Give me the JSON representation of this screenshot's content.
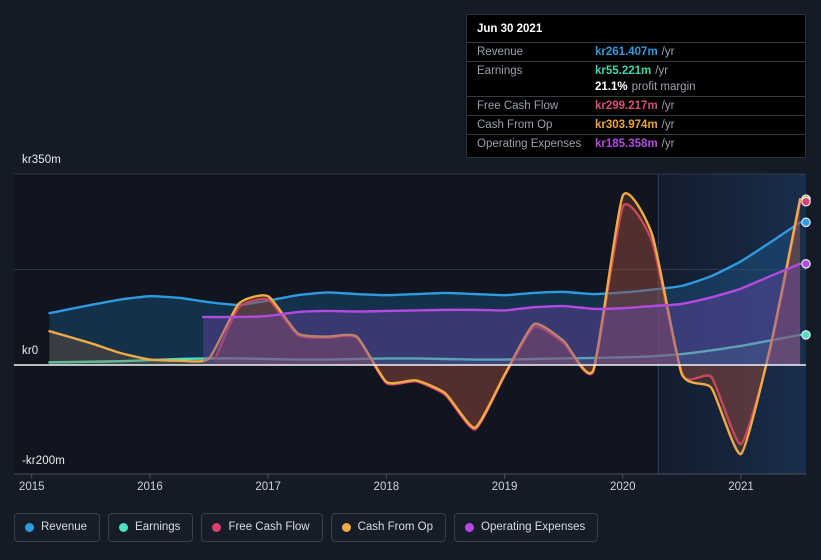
{
  "axis": {
    "y_labels": [
      {
        "text": "kr350m",
        "value": 350,
        "y": 161
      },
      {
        "text": "kr0",
        "value": 0,
        "y": 352
      },
      {
        "text": "-kr200m",
        "value": -200,
        "y": 462
      }
    ],
    "x_labels": [
      "2015",
      "2016",
      "2017",
      "2018",
      "2019",
      "2020",
      "2021"
    ]
  },
  "tooltip": {
    "date": "Jun 30 2021",
    "rows": [
      {
        "label": "Revenue",
        "value": "kr261.407m",
        "unit": "/yr",
        "color": "#2e9ae0"
      },
      {
        "label": "Earnings",
        "value": "kr55.221m",
        "unit": "/yr",
        "color": "#3ad6ae"
      },
      {
        "label": "",
        "value": "21.1%",
        "unit": "profit margin",
        "color": "#ffffff",
        "sub": true
      },
      {
        "label": "Free Cash Flow",
        "value": "kr299.217m",
        "unit": "/yr",
        "color": "#d84d7c"
      },
      {
        "label": "Cash From Op",
        "value": "kr303.974m",
        "unit": "/yr",
        "color": "#e8a33d"
      },
      {
        "label": "Operating Expenses",
        "value": "kr185.358m",
        "unit": "/yr",
        "color": "#b44ae0"
      }
    ]
  },
  "legend": {
    "items": [
      {
        "label": "Revenue",
        "color": "#2e9ae0"
      },
      {
        "label": "Earnings",
        "color": "#4fe0c0"
      },
      {
        "label": "Free Cash Flow",
        "color": "#d8416f"
      },
      {
        "label": "Cash From Op",
        "color": "#f0ab47"
      },
      {
        "label": "Operating Expenses",
        "color": "#b44ae0"
      }
    ]
  },
  "chart_data": {
    "type": "area",
    "title": "",
    "xlabel": "",
    "ylabel": "",
    "currency": "kr",
    "unit": "m",
    "ylim": [
      -200,
      350
    ],
    "grid": true,
    "gridlines": [
      350,
      175,
      0
    ],
    "zero_line": 0,
    "x": [
      "2015.00",
      "2015.25",
      "2015.50",
      "2015.75",
      "2016.00",
      "2016.25",
      "2016.50",
      "2016.75",
      "2017.00",
      "2017.25",
      "2017.50",
      "2017.75",
      "2018.00",
      "2018.25",
      "2018.50",
      "2018.75",
      "2019.00",
      "2019.25",
      "2019.50",
      "2019.75",
      "2020.00",
      "2020.25",
      "2020.50",
      "2020.75",
      "2021.00",
      "2021.25",
      "2021.50"
    ],
    "xlim": [
      "2014.85",
      "2021.55"
    ],
    "highlight_region_start": "2020.30",
    "series": [
      {
        "name": "Revenue",
        "color": "#2e9ae0",
        "fill": "rgba(30,95,150,0.38)",
        "start_x": "2015.15",
        "values": [
          null,
          95,
          110,
          120,
          126,
          123,
          115,
          110,
          118,
          128,
          133,
          130,
          128,
          130,
          132,
          130,
          128,
          132,
          134,
          130,
          133,
          138,
          145,
          163,
          190,
          225,
          261.407
        ]
      },
      {
        "name": "Earnings",
        "color": "#4fe0c0",
        "fill": "rgba(80,200,170,0.14)",
        "start_x": "2015.15",
        "values": [
          null,
          5,
          6,
          7,
          9,
          11,
          12,
          12,
          11,
          10,
          10,
          11,
          12,
          12,
          11,
          10,
          10,
          11,
          12,
          13,
          14,
          16,
          20,
          27,
          35,
          45,
          55.221
        ]
      },
      {
        "name": "Free Cash Flow",
        "color": "#d8416f",
        "fill": "rgba(150,55,80,0.30)",
        "start_x": "2016.55",
        "values": [
          null,
          null,
          null,
          null,
          null,
          null,
          10,
          105,
          120,
          55,
          50,
          50,
          -33,
          -30,
          -55,
          -118,
          -20,
          70,
          40,
          -12,
          290,
          225,
          -18,
          -22,
          -145,
          30,
          299.217
        ]
      },
      {
        "name": "Cash From Op",
        "color": "#f0ab47",
        "fill": "rgba(150,90,45,0.28)",
        "start_x": "2015.15",
        "values": [
          null,
          62,
          40,
          22,
          10,
          8,
          12,
          112,
          126,
          58,
          52,
          52,
          -31,
          -28,
          -52,
          -115,
          -18,
          75,
          44,
          -10,
          310,
          238,
          -16,
          -42,
          -163,
          35,
          303.974
        ]
      },
      {
        "name": "Operating Expenses",
        "color": "#b44ae0",
        "fill": "rgba(110,70,170,0.40)",
        "start_x": "2016.45",
        "values": [
          null,
          null,
          null,
          null,
          null,
          null,
          88,
          88,
          90,
          97,
          99,
          98,
          99,
          100,
          101,
          101,
          100,
          106,
          108,
          103,
          104,
          108,
          112,
          124,
          140,
          163,
          185.358
        ]
      }
    ],
    "end_markers": [
      {
        "name": "Cash From Op",
        "value": 303.974,
        "color": "#f0ab47"
      },
      {
        "name": "Free Cash Flow",
        "value": 299.217,
        "color": "#d8416f"
      },
      {
        "name": "Revenue",
        "value": 261.407,
        "color": "#2e9ae0"
      },
      {
        "name": "Operating Expenses",
        "value": 185.358,
        "color": "#b44ae0"
      },
      {
        "name": "Earnings",
        "value": 55.221,
        "color": "#4fe0c0"
      }
    ]
  }
}
